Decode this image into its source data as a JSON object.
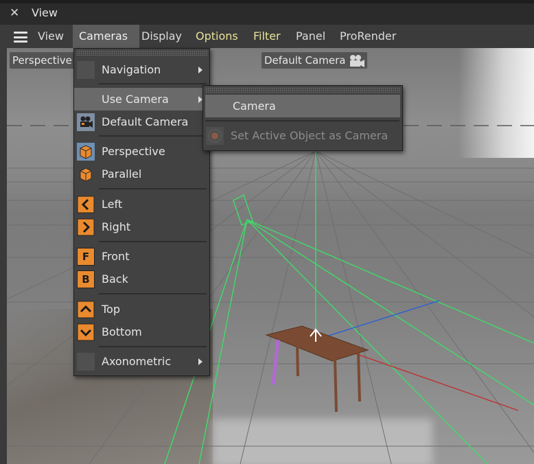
{
  "window": {
    "close_glyph": "✕",
    "title": "View"
  },
  "menubar": {
    "items": [
      {
        "label": "View"
      },
      {
        "label": "Cameras"
      },
      {
        "label": "Display"
      },
      {
        "label": "Options"
      },
      {
        "label": "Filter"
      },
      {
        "label": "Panel"
      },
      {
        "label": "ProRender"
      }
    ],
    "active": "Cameras",
    "colors": {
      "default": "#dcdcdc",
      "highlight": "#e8e29a"
    }
  },
  "viewport": {
    "projection_label": "Perspective",
    "camera_label": "Default Camera"
  },
  "cameras_menu": {
    "items": [
      {
        "label": "Navigation",
        "icon": "blank-icon",
        "submenu": true
      },
      {
        "label": "Use Camera",
        "icon": "none",
        "submenu": true,
        "highlighted": true
      },
      {
        "label": "Default Camera",
        "icon": "film-camera-icon"
      },
      {
        "label": "Perspective",
        "icon": "perspective-cube-icon"
      },
      {
        "label": "Parallel",
        "icon": "parallel-cube-icon"
      },
      {
        "label": "Left",
        "icon": "left-arrow-icon"
      },
      {
        "label": "Right",
        "icon": "right-arrow-icon"
      },
      {
        "label": "Front",
        "icon": "front-f-icon",
        "glyph": "F"
      },
      {
        "label": "Back",
        "icon": "back-b-icon",
        "glyph": "B"
      },
      {
        "label": "Top",
        "icon": "top-arrow-icon"
      },
      {
        "label": "Bottom",
        "icon": "bottom-arrow-icon"
      },
      {
        "label": "Axonometric",
        "icon": "blank-icon",
        "submenu": true
      }
    ]
  },
  "use_camera_submenu": {
    "items": [
      {
        "label": "Camera",
        "highlighted": true
      },
      {
        "label": "Set Active Object as Camera",
        "disabled": true,
        "icon": "target-icon"
      }
    ]
  },
  "accent_colors": {
    "icon_orange": "#ea8a2e",
    "axis_green": "#3fdc6a",
    "axis_blue": "#2a5fd6",
    "axis_red": "#c03030",
    "table_wood": "#7a4a32"
  }
}
